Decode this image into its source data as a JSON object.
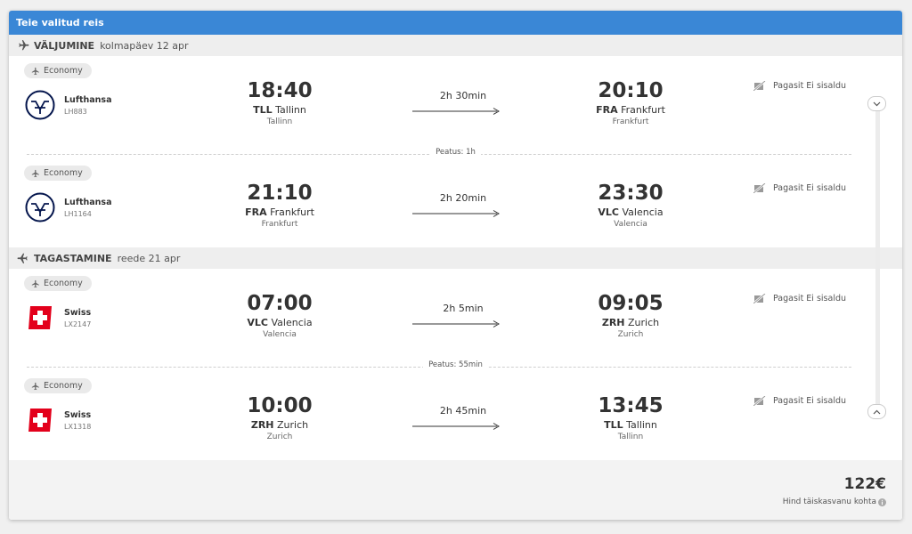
{
  "header": {
    "title": "Teie valitud reis"
  },
  "outbound": {
    "title": "VÄLJUMINE",
    "date": "kolmapäev 12 apr",
    "segments": [
      {
        "cabin": "Economy",
        "airline": "Lufthansa",
        "flight": "LH883",
        "dep_time": "18:40",
        "dep_code": "TLL",
        "dep_city": "Tallinn",
        "dep_city_sub": "Tallinn",
        "duration": "2h 30min",
        "arr_time": "20:10",
        "arr_code": "FRA",
        "arr_city": "Frankfurt",
        "arr_city_sub": "Frankfurt",
        "baggage": "Pagasit Ei sisaldu"
      },
      {
        "cabin": "Economy",
        "airline": "Lufthansa",
        "flight": "LH1164",
        "dep_time": "21:10",
        "dep_code": "FRA",
        "dep_city": "Frankfurt",
        "dep_city_sub": "Frankfurt",
        "duration": "2h 20min",
        "arr_time": "23:30",
        "arr_code": "VLC",
        "arr_city": "Valencia",
        "arr_city_sub": "Valencia",
        "baggage": "Pagasit Ei sisaldu"
      }
    ],
    "stop": "Peatus: 1h"
  },
  "return": {
    "title": "TAGASTAMINE",
    "date": "reede 21 apr",
    "segments": [
      {
        "cabin": "Economy",
        "airline": "Swiss",
        "flight": "LX2147",
        "dep_time": "07:00",
        "dep_code": "VLC",
        "dep_city": "Valencia",
        "dep_city_sub": "Valencia",
        "duration": "2h 5min",
        "arr_time": "09:05",
        "arr_code": "ZRH",
        "arr_city": "Zurich",
        "arr_city_sub": "Zurich",
        "baggage": "Pagasit Ei sisaldu"
      },
      {
        "cabin": "Economy",
        "airline": "Swiss",
        "flight": "LX1318",
        "dep_time": "10:00",
        "dep_code": "ZRH",
        "dep_city": "Zurich",
        "dep_city_sub": "Zurich",
        "duration": "2h 45min",
        "arr_time": "13:45",
        "arr_code": "TLL",
        "arr_city": "Tallinn",
        "arr_city_sub": "Tallinn",
        "baggage": "Pagasit Ei sisaldu"
      }
    ],
    "stop": "Peatus: 55min"
  },
  "footer": {
    "price": "122€",
    "price_label": "Hind täiskasvanu kohta"
  },
  "colors": {
    "header": "#3a87d6",
    "lufthansa": "#05164d",
    "swiss": "#e3001b"
  },
  "icons": [
    "plane-icon",
    "baggage-crossed-icon",
    "chevron-down-icon",
    "chevron-up-icon",
    "info-icon",
    "lufthansa-logo",
    "swiss-logo"
  ]
}
